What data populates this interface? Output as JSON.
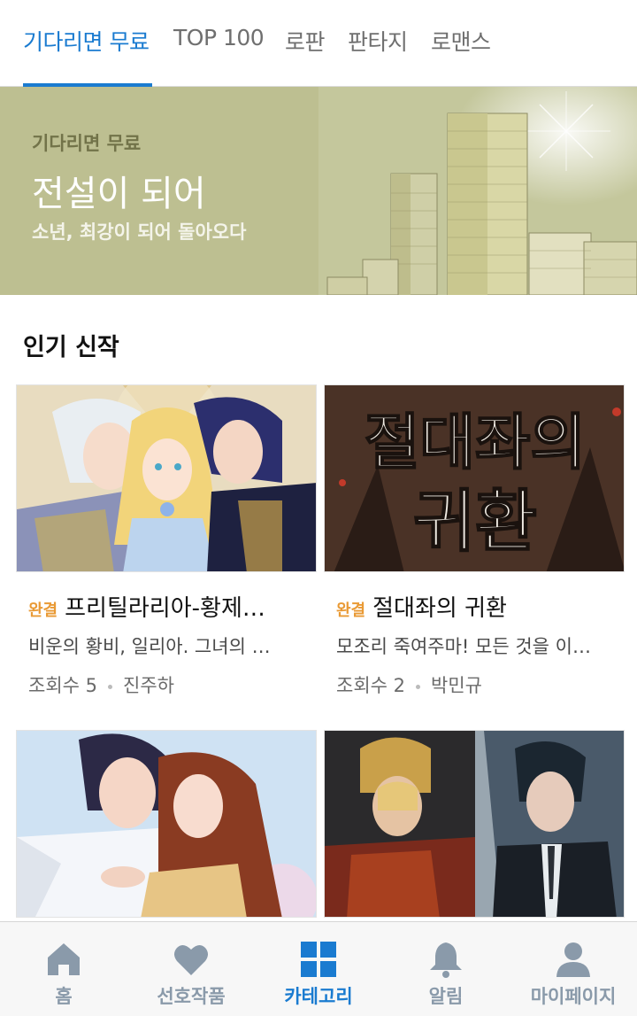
{
  "tabs": [
    {
      "label": "기다리면 무료",
      "active": true
    },
    {
      "label": "TOP 100",
      "active": false
    },
    {
      "label": "로판",
      "active": false
    },
    {
      "label": "판타지",
      "active": false
    },
    {
      "label": "로맨스",
      "active": false
    }
  ],
  "banner": {
    "subtitle": "기다리면 무료",
    "title": "전설이 되어",
    "description": "소년, 최강이 되어 돌아오다"
  },
  "section": {
    "title": "인기 신작"
  },
  "cards": [
    {
      "badge": "완결",
      "title": "프리틸라리아-황제…",
      "description": "비운의 황비, 일리아. 그녀의 …",
      "views": "조회수 5",
      "author": "진주하"
    },
    {
      "badge": "완결",
      "title": "절대좌의 귀환",
      "description": "모조리 죽여주마! 모든 것을 이…",
      "views": "조회수 2",
      "author": "박민규",
      "cover_text": [
        "절대좌의",
        "귀환"
      ]
    },
    {
      "badge": "",
      "title": "",
      "description": "",
      "views": "",
      "author": ""
    },
    {
      "badge": "",
      "title": "",
      "description": "",
      "views": "",
      "author": ""
    }
  ],
  "bottom_nav": [
    {
      "label": "홈",
      "icon": "home-icon"
    },
    {
      "label": "선호작품",
      "icon": "heart-icon"
    },
    {
      "label": "카테고리",
      "icon": "grid-icon",
      "active": true
    },
    {
      "label": "알림",
      "icon": "bell-icon"
    },
    {
      "label": "마이페이지",
      "icon": "person-icon"
    }
  ],
  "colors": {
    "accent": "#1a7bd0",
    "badge": "#e99a35",
    "banner_bg": "#bdbf91",
    "nav_inactive": "#8a9aaa"
  }
}
